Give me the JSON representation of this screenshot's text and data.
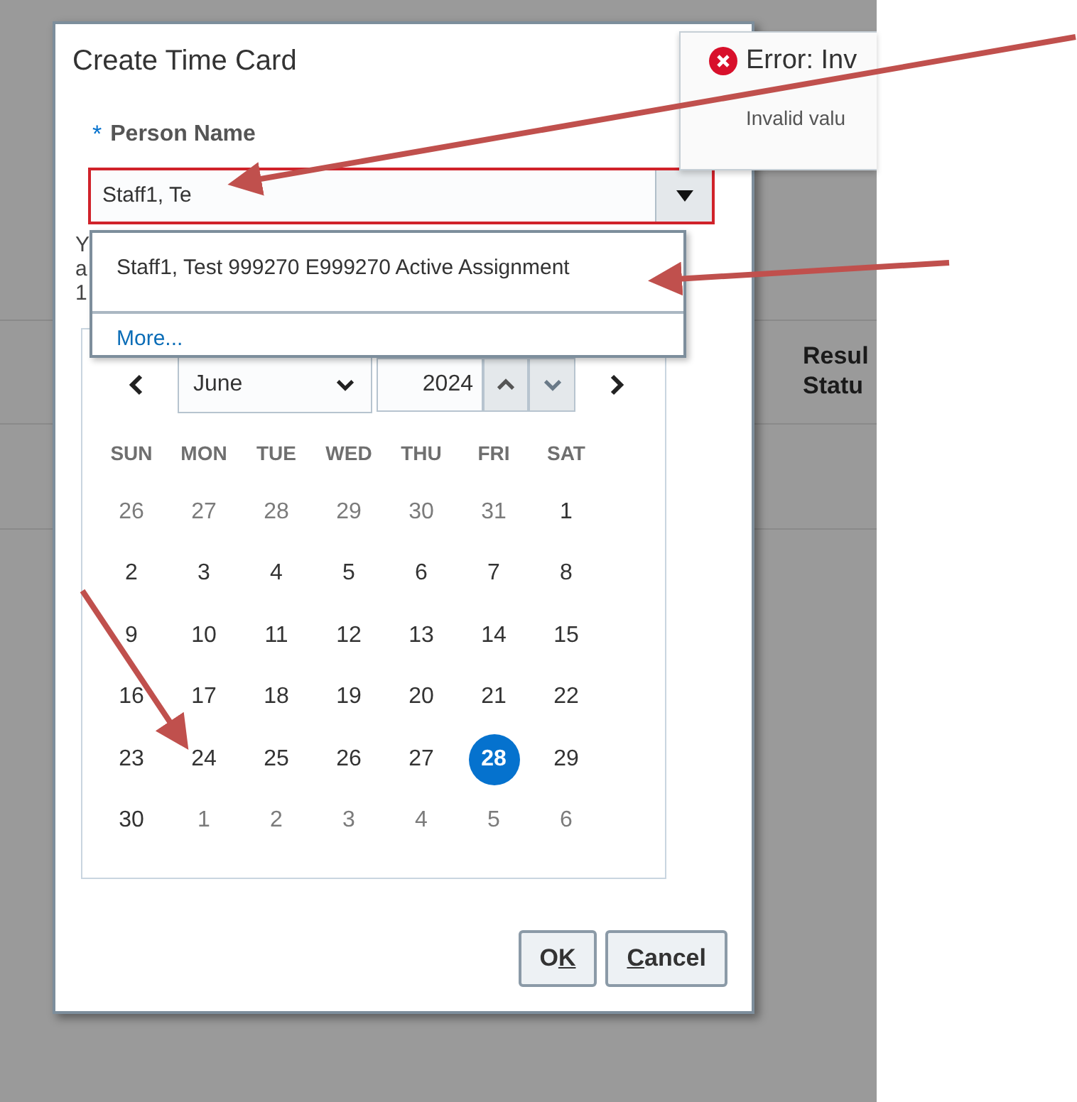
{
  "background_table": {
    "header_lines": [
      "Resul",
      "Statu"
    ]
  },
  "dialog": {
    "title": "Create Time Card",
    "person_field": {
      "required_mark": "*",
      "label": "Person Name",
      "value": "Staff1, Te",
      "invalid": true,
      "expanded": true,
      "suggestions": [
        {
          "kind": "option",
          "text": "Staff1, Test 999270 E999270 Active Assignment"
        },
        {
          "kind": "link",
          "text": "More..."
        }
      ]
    },
    "helper_lines": [
      "Y",
      "a",
      "1"
    ],
    "calendar": {
      "month": "June",
      "year": "2024",
      "weekdays": [
        "SUN",
        "MON",
        "TUE",
        "WED",
        "THU",
        "FRI",
        "SAT"
      ],
      "weeks": [
        [
          {
            "day": "26",
            "other_month": true,
            "selected": false
          },
          {
            "day": "27",
            "other_month": true,
            "selected": false
          },
          {
            "day": "28",
            "other_month": true,
            "selected": false
          },
          {
            "day": "29",
            "other_month": true,
            "selected": false
          },
          {
            "day": "30",
            "other_month": true,
            "selected": false
          },
          {
            "day": "31",
            "other_month": true,
            "selected": false
          },
          {
            "day": "1",
            "other_month": false,
            "selected": false
          }
        ],
        [
          {
            "day": "2",
            "other_month": false,
            "selected": false
          },
          {
            "day": "3",
            "other_month": false,
            "selected": false
          },
          {
            "day": "4",
            "other_month": false,
            "selected": false
          },
          {
            "day": "5",
            "other_month": false,
            "selected": false
          },
          {
            "day": "6",
            "other_month": false,
            "selected": false
          },
          {
            "day": "7",
            "other_month": false,
            "selected": false
          },
          {
            "day": "8",
            "other_month": false,
            "selected": false
          }
        ],
        [
          {
            "day": "9",
            "other_month": false,
            "selected": false
          },
          {
            "day": "10",
            "other_month": false,
            "selected": false
          },
          {
            "day": "11",
            "other_month": false,
            "selected": false
          },
          {
            "day": "12",
            "other_month": false,
            "selected": false
          },
          {
            "day": "13",
            "other_month": false,
            "selected": false
          },
          {
            "day": "14",
            "other_month": false,
            "selected": false
          },
          {
            "day": "15",
            "other_month": false,
            "selected": false
          }
        ],
        [
          {
            "day": "16",
            "other_month": false,
            "selected": false
          },
          {
            "day": "17",
            "other_month": false,
            "selected": false
          },
          {
            "day": "18",
            "other_month": false,
            "selected": false
          },
          {
            "day": "19",
            "other_month": false,
            "selected": false
          },
          {
            "day": "20",
            "other_month": false,
            "selected": false
          },
          {
            "day": "21",
            "other_month": false,
            "selected": false
          },
          {
            "day": "22",
            "other_month": false,
            "selected": false
          }
        ],
        [
          {
            "day": "23",
            "other_month": false,
            "selected": false
          },
          {
            "day": "24",
            "other_month": false,
            "selected": false
          },
          {
            "day": "25",
            "other_month": false,
            "selected": false
          },
          {
            "day": "26",
            "other_month": false,
            "selected": false
          },
          {
            "day": "27",
            "other_month": false,
            "selected": false
          },
          {
            "day": "28",
            "other_month": false,
            "selected": true
          },
          {
            "day": "29",
            "other_month": false,
            "selected": false
          }
        ],
        [
          {
            "day": "30",
            "other_month": false,
            "selected": false
          },
          {
            "day": "1",
            "other_month": true,
            "selected": false
          },
          {
            "day": "2",
            "other_month": true,
            "selected": false
          },
          {
            "day": "3",
            "other_month": true,
            "selected": false
          },
          {
            "day": "4",
            "other_month": true,
            "selected": false
          },
          {
            "day": "5",
            "other_month": true,
            "selected": false
          },
          {
            "day": "6",
            "other_month": true,
            "selected": false
          }
        ]
      ]
    },
    "buttons": [
      {
        "text_before": "O",
        "access_key": "K"
      },
      {
        "access_key": "C",
        "text_after": "ancel"
      }
    ]
  },
  "error_popup": {
    "title": "Error: Inv",
    "message": "Invalid valu"
  }
}
